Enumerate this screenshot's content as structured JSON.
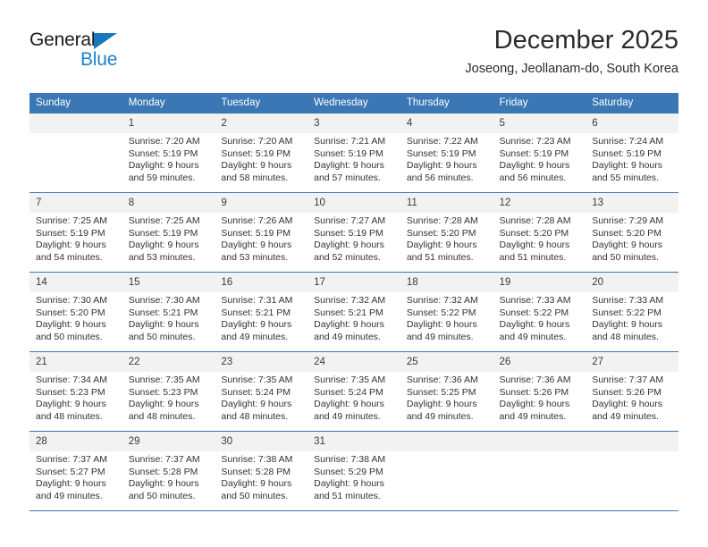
{
  "brand": {
    "name_top": "General",
    "name_bottom": "Blue",
    "triangle_color": "#1878be",
    "blue_color": "#1f82c9"
  },
  "header": {
    "title": "December 2025",
    "location": "Joseong, Jeollanam-do, South Korea"
  },
  "theme": {
    "header_blue": "#3b77b4",
    "daynum_band": "#f2f2f2",
    "text": "#333333"
  },
  "calendar": {
    "weekday_headers": [
      "Sunday",
      "Monday",
      "Tuesday",
      "Wednesday",
      "Thursday",
      "Friday",
      "Saturday"
    ],
    "labels": {
      "sunrise_prefix": "Sunrise:",
      "sunset_prefix": "Sunset:",
      "daylight_prefix": "Daylight:"
    },
    "weeks": [
      [
        {
          "day": "",
          "lines": []
        },
        {
          "day": "1",
          "lines": [
            "Sunrise: 7:20 AM",
            "Sunset: 5:19 PM",
            "Daylight: 9 hours",
            "and 59 minutes."
          ]
        },
        {
          "day": "2",
          "lines": [
            "Sunrise: 7:20 AM",
            "Sunset: 5:19 PM",
            "Daylight: 9 hours",
            "and 58 minutes."
          ]
        },
        {
          "day": "3",
          "lines": [
            "Sunrise: 7:21 AM",
            "Sunset: 5:19 PM",
            "Daylight: 9 hours",
            "and 57 minutes."
          ]
        },
        {
          "day": "4",
          "lines": [
            "Sunrise: 7:22 AM",
            "Sunset: 5:19 PM",
            "Daylight: 9 hours",
            "and 56 minutes."
          ]
        },
        {
          "day": "5",
          "lines": [
            "Sunrise: 7:23 AM",
            "Sunset: 5:19 PM",
            "Daylight: 9 hours",
            "and 56 minutes."
          ]
        },
        {
          "day": "6",
          "lines": [
            "Sunrise: 7:24 AM",
            "Sunset: 5:19 PM",
            "Daylight: 9 hours",
            "and 55 minutes."
          ]
        }
      ],
      [
        {
          "day": "7",
          "lines": [
            "Sunrise: 7:25 AM",
            "Sunset: 5:19 PM",
            "Daylight: 9 hours",
            "and 54 minutes."
          ]
        },
        {
          "day": "8",
          "lines": [
            "Sunrise: 7:25 AM",
            "Sunset: 5:19 PM",
            "Daylight: 9 hours",
            "and 53 minutes."
          ]
        },
        {
          "day": "9",
          "lines": [
            "Sunrise: 7:26 AM",
            "Sunset: 5:19 PM",
            "Daylight: 9 hours",
            "and 53 minutes."
          ]
        },
        {
          "day": "10",
          "lines": [
            "Sunrise: 7:27 AM",
            "Sunset: 5:19 PM",
            "Daylight: 9 hours",
            "and 52 minutes."
          ]
        },
        {
          "day": "11",
          "lines": [
            "Sunrise: 7:28 AM",
            "Sunset: 5:20 PM",
            "Daylight: 9 hours",
            "and 51 minutes."
          ]
        },
        {
          "day": "12",
          "lines": [
            "Sunrise: 7:28 AM",
            "Sunset: 5:20 PM",
            "Daylight: 9 hours",
            "and 51 minutes."
          ]
        },
        {
          "day": "13",
          "lines": [
            "Sunrise: 7:29 AM",
            "Sunset: 5:20 PM",
            "Daylight: 9 hours",
            "and 50 minutes."
          ]
        }
      ],
      [
        {
          "day": "14",
          "lines": [
            "Sunrise: 7:30 AM",
            "Sunset: 5:20 PM",
            "Daylight: 9 hours",
            "and 50 minutes."
          ]
        },
        {
          "day": "15",
          "lines": [
            "Sunrise: 7:30 AM",
            "Sunset: 5:21 PM",
            "Daylight: 9 hours",
            "and 50 minutes."
          ]
        },
        {
          "day": "16",
          "lines": [
            "Sunrise: 7:31 AM",
            "Sunset: 5:21 PM",
            "Daylight: 9 hours",
            "and 49 minutes."
          ]
        },
        {
          "day": "17",
          "lines": [
            "Sunrise: 7:32 AM",
            "Sunset: 5:21 PM",
            "Daylight: 9 hours",
            "and 49 minutes."
          ]
        },
        {
          "day": "18",
          "lines": [
            "Sunrise: 7:32 AM",
            "Sunset: 5:22 PM",
            "Daylight: 9 hours",
            "and 49 minutes."
          ]
        },
        {
          "day": "19",
          "lines": [
            "Sunrise: 7:33 AM",
            "Sunset: 5:22 PM",
            "Daylight: 9 hours",
            "and 49 minutes."
          ]
        },
        {
          "day": "20",
          "lines": [
            "Sunrise: 7:33 AM",
            "Sunset: 5:22 PM",
            "Daylight: 9 hours",
            "and 48 minutes."
          ]
        }
      ],
      [
        {
          "day": "21",
          "lines": [
            "Sunrise: 7:34 AM",
            "Sunset: 5:23 PM",
            "Daylight: 9 hours",
            "and 48 minutes."
          ]
        },
        {
          "day": "22",
          "lines": [
            "Sunrise: 7:35 AM",
            "Sunset: 5:23 PM",
            "Daylight: 9 hours",
            "and 48 minutes."
          ]
        },
        {
          "day": "23",
          "lines": [
            "Sunrise: 7:35 AM",
            "Sunset: 5:24 PM",
            "Daylight: 9 hours",
            "and 48 minutes."
          ]
        },
        {
          "day": "24",
          "lines": [
            "Sunrise: 7:35 AM",
            "Sunset: 5:24 PM",
            "Daylight: 9 hours",
            "and 49 minutes."
          ]
        },
        {
          "day": "25",
          "lines": [
            "Sunrise: 7:36 AM",
            "Sunset: 5:25 PM",
            "Daylight: 9 hours",
            "and 49 minutes."
          ]
        },
        {
          "day": "26",
          "lines": [
            "Sunrise: 7:36 AM",
            "Sunset: 5:26 PM",
            "Daylight: 9 hours",
            "and 49 minutes."
          ]
        },
        {
          "day": "27",
          "lines": [
            "Sunrise: 7:37 AM",
            "Sunset: 5:26 PM",
            "Daylight: 9 hours",
            "and 49 minutes."
          ]
        }
      ],
      [
        {
          "day": "28",
          "lines": [
            "Sunrise: 7:37 AM",
            "Sunset: 5:27 PM",
            "Daylight: 9 hours",
            "and 49 minutes."
          ]
        },
        {
          "day": "29",
          "lines": [
            "Sunrise: 7:37 AM",
            "Sunset: 5:28 PM",
            "Daylight: 9 hours",
            "and 50 minutes."
          ]
        },
        {
          "day": "30",
          "lines": [
            "Sunrise: 7:38 AM",
            "Sunset: 5:28 PM",
            "Daylight: 9 hours",
            "and 50 minutes."
          ]
        },
        {
          "day": "31",
          "lines": [
            "Sunrise: 7:38 AM",
            "Sunset: 5:29 PM",
            "Daylight: 9 hours",
            "and 51 minutes."
          ]
        },
        {
          "day": "",
          "lines": []
        },
        {
          "day": "",
          "lines": []
        },
        {
          "day": "",
          "lines": []
        }
      ]
    ]
  }
}
